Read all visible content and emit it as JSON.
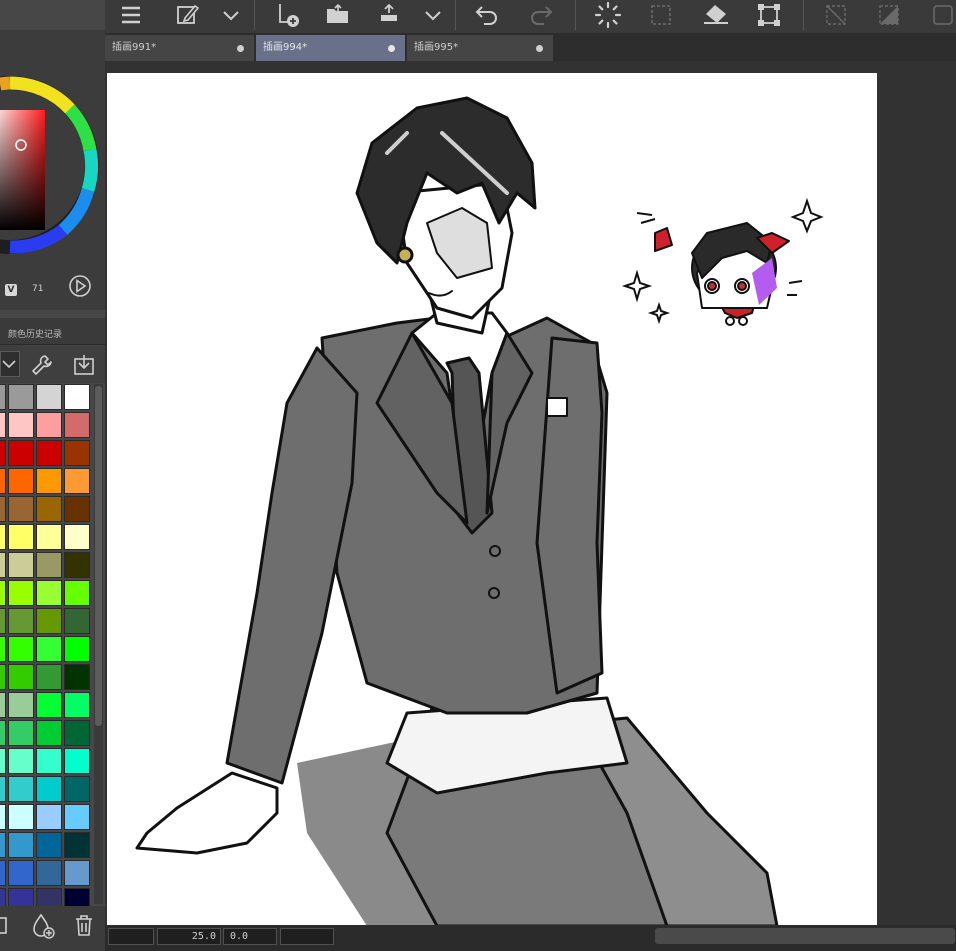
{
  "tabs": [
    {
      "label": "插画991*",
      "active": false
    },
    {
      "label": "插画994*",
      "active": true
    },
    {
      "label": "插画995*",
      "active": false
    }
  ],
  "color_panel": {
    "v_label": "V",
    "v_value": "71"
  },
  "palette_tab": {
    "label": "颜色历史记录"
  },
  "statusbar": {
    "zoom": "25.0",
    "angle": "0.0"
  },
  "palette_colors": [
    [
      "#9a9a9a",
      "#d4d4d4",
      "#ffffff"
    ],
    [
      "#ffc6c6",
      "#ff9e9e",
      "#d46b6b"
    ],
    [
      "#cc0000",
      "#cc0000",
      "#993300"
    ],
    [
      "#ff6600",
      "#ff9900",
      "#ff9933"
    ],
    [
      "#996633",
      "#996600",
      "#663300"
    ],
    [
      "#ffff66",
      "#ffff99",
      "#ffffcc"
    ],
    [
      "#cccc99",
      "#999966",
      "#333300"
    ],
    [
      "#99ff00",
      "#99ff33",
      "#66ff00"
    ],
    [
      "#669933",
      "#669900",
      "#336633"
    ],
    [
      "#33ff00",
      "#33ff33",
      "#00ff00"
    ],
    [
      "#33cc00",
      "#339933",
      "#003300"
    ],
    [
      "#99cc99",
      "#00ff33",
      "#00ff66"
    ],
    [
      "#33cc66",
      "#00cc33",
      "#006633"
    ],
    [
      "#66ffcc",
      "#33ffcc",
      "#00ffcc"
    ],
    [
      "#33cccc",
      "#00cccc",
      "#006666"
    ],
    [
      "#ccffff",
      "#99ccff",
      "#66ccff"
    ],
    [
      "#3399cc",
      "#006699",
      "#003333"
    ],
    [
      "#3366cc",
      "#336699",
      "#6699cc"
    ],
    [
      "#333399",
      "#333366",
      "#000033"
    ]
  ]
}
